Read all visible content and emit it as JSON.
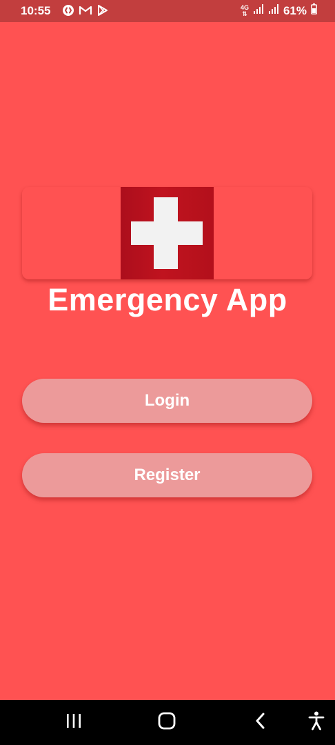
{
  "status_bar": {
    "time": "10:55",
    "network_type": "4G",
    "battery": "61%",
    "icons": [
      "shazam-icon",
      "gmail-icon",
      "play-store-icon",
      "signal-icon",
      "signal-icon",
      "battery-icon"
    ]
  },
  "main": {
    "title": "Emergency App",
    "login_label": "Login",
    "register_label": "Register"
  },
  "nav_bar": {
    "icons": [
      "recent-apps-icon",
      "home-icon",
      "back-icon",
      "accessibility-icon"
    ]
  },
  "colors": {
    "background": "#FF5252",
    "status_bar": "#C23E3E",
    "button": "#EC9A9A",
    "flag_red": "#B3101B",
    "cross": "#F2F2F2"
  }
}
